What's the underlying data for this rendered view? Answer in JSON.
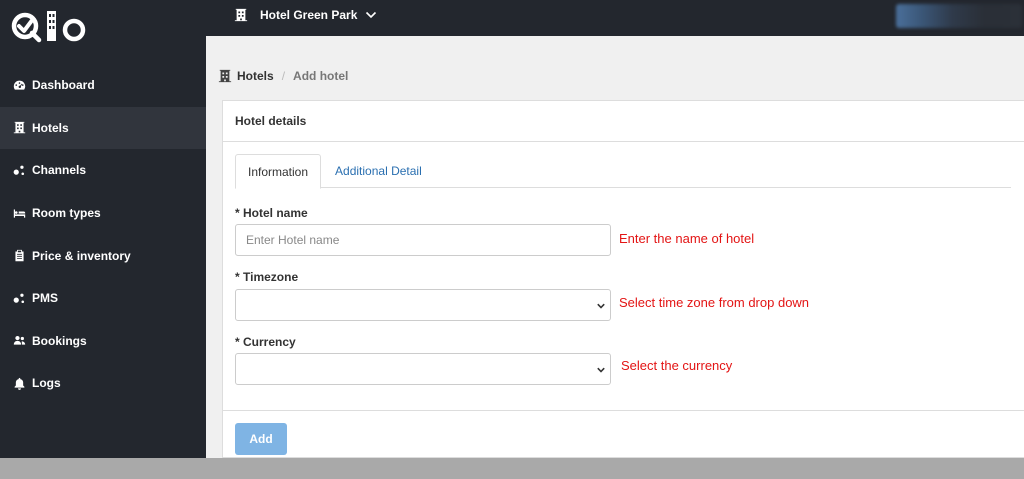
{
  "sidebar": {
    "logo_text": "Qio",
    "items": [
      {
        "label": "Dashboard",
        "icon": "dashboard-icon",
        "active": false
      },
      {
        "label": "Hotels",
        "icon": "hotel-icon",
        "active": true
      },
      {
        "label": "Channels",
        "icon": "channels-icon",
        "active": false
      },
      {
        "label": "Room types",
        "icon": "bed-icon",
        "active": false
      },
      {
        "label": "Price & inventory",
        "icon": "clipboard-icon",
        "active": false
      },
      {
        "label": "PMS",
        "icon": "pms-icon",
        "active": false
      },
      {
        "label": "Bookings",
        "icon": "users-icon",
        "active": false
      },
      {
        "label": "Logs",
        "icon": "bell-icon",
        "active": false
      }
    ]
  },
  "topbar": {
    "hotel_name": "Hotel Green Park"
  },
  "breadcrumb": {
    "parent": "Hotels",
    "current": "Add hotel"
  },
  "card": {
    "title": "Hotel details",
    "tabs": [
      {
        "label": "Information",
        "active": true
      },
      {
        "label": "Additional Detail",
        "active": false
      }
    ],
    "fields": {
      "hotel_name": {
        "label": "* Hotel name",
        "value": "",
        "placeholder": "Enter Hotel name",
        "hint": "Enter the name of hotel"
      },
      "timezone": {
        "label": "* Timezone",
        "value": "",
        "hint": "Select time zone from drop down"
      },
      "currency": {
        "label": "* Currency",
        "value": "",
        "hint": "Select the currency"
      }
    },
    "submit_label": "Add"
  },
  "colors": {
    "sidebar_bg": "#23272e",
    "active_item_bg": "#31353d",
    "hint_red": "#e31414",
    "link_blue": "#2a6fb0",
    "button_blue": "#7fb4e4"
  }
}
